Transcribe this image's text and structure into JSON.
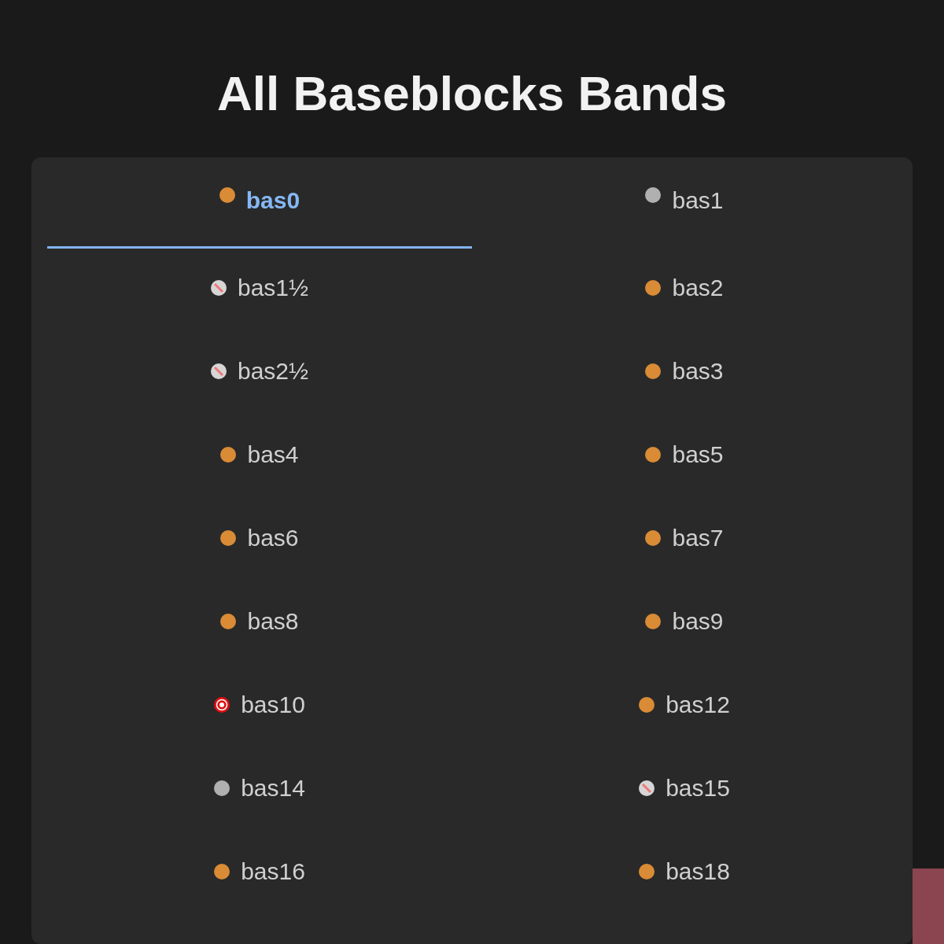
{
  "title": "All Baseblocks Bands",
  "tabs": [
    {
      "label": "bas0",
      "kind": "ok",
      "selected": true
    },
    {
      "label": "bas1",
      "kind": "idle",
      "selected": false
    },
    {
      "label": "bas1½",
      "kind": "off",
      "selected": false
    },
    {
      "label": "bas2",
      "kind": "ok",
      "selected": false
    },
    {
      "label": "bas2½",
      "kind": "off",
      "selected": false
    },
    {
      "label": "bas3",
      "kind": "ok",
      "selected": false
    },
    {
      "label": "bas4",
      "kind": "ok",
      "selected": false
    },
    {
      "label": "bas5",
      "kind": "ok",
      "selected": false
    },
    {
      "label": "bas6",
      "kind": "ok",
      "selected": false
    },
    {
      "label": "bas7",
      "kind": "ok",
      "selected": false
    },
    {
      "label": "bas8",
      "kind": "ok",
      "selected": false
    },
    {
      "label": "bas9",
      "kind": "ok",
      "selected": false
    },
    {
      "label": "bas10",
      "kind": "alert",
      "selected": false
    },
    {
      "label": "bas12",
      "kind": "ok",
      "selected": false
    },
    {
      "label": "bas14",
      "kind": "idle",
      "selected": false
    },
    {
      "label": "bas15",
      "kind": "off",
      "selected": false
    },
    {
      "label": "bas16",
      "kind": "ok",
      "selected": false
    },
    {
      "label": "bas18",
      "kind": "ok",
      "selected": false
    }
  ]
}
